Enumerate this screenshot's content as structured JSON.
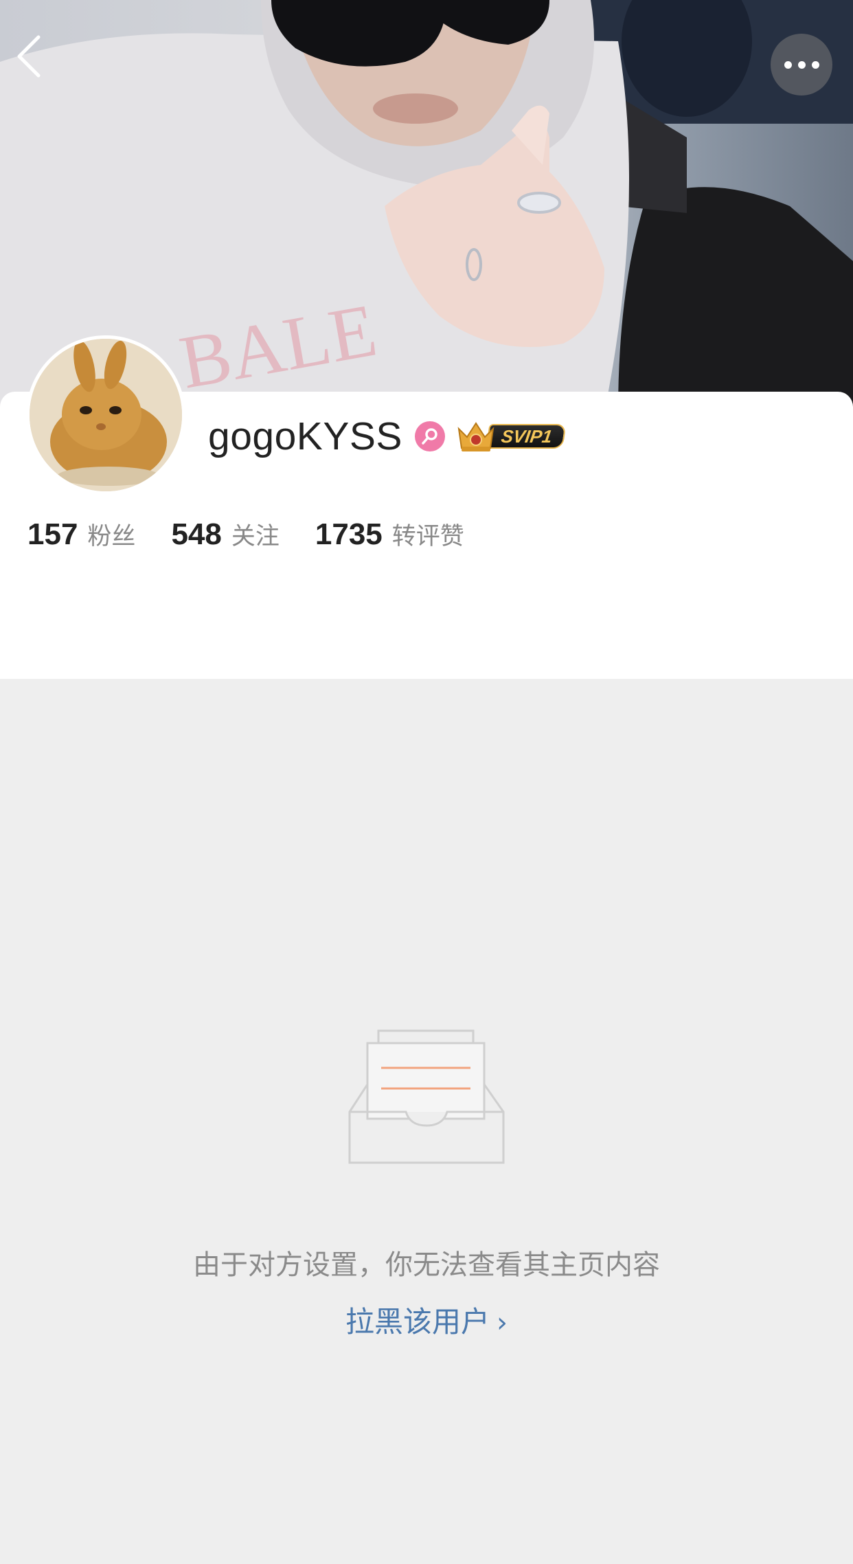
{
  "profile": {
    "username": "gogoKYSS",
    "vip_badge": "SVIP1",
    "colors": {
      "gender_badge": "#f07aa8",
      "vip_gold": "#f4c75a",
      "link": "#4a78ad"
    }
  },
  "stats": [
    {
      "value": "157",
      "label": "粉丝"
    },
    {
      "value": "548",
      "label": "关注"
    },
    {
      "value": "1735",
      "label": "转评赞"
    }
  ],
  "empty_state": {
    "message": "由于对方设置，你无法查看其主页内容",
    "link_label": "拉黑该用户",
    "link_chevron": "›"
  },
  "icons": {
    "back": "chevron-left-icon",
    "more": "more-dots-icon",
    "gender": "female-icon",
    "vip": "crown-icon",
    "empty": "inbox-tray-icon"
  }
}
